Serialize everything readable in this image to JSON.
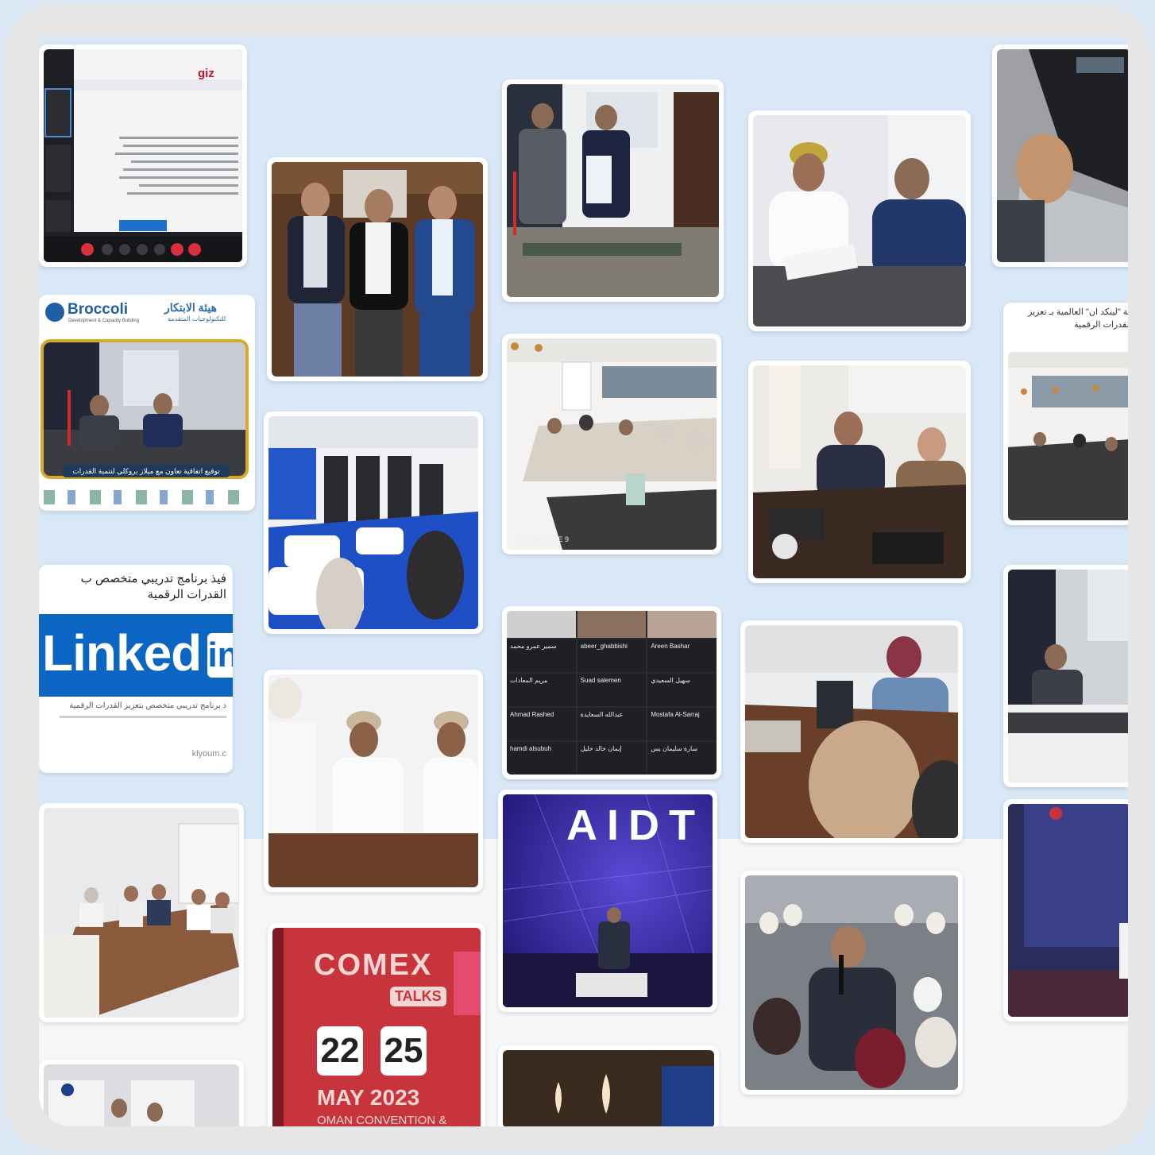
{
  "collage": {
    "logos": {
      "giz": "giz",
      "broccoli": "Broccoli",
      "broccoli_sub": "Development & Capacity Building",
      "innovation_arabic": "هيئة الابتكار",
      "innovation_sub": "للتكنولوجيات المتقدمة"
    },
    "captions": {
      "agreement_banner": "توقيع اتفاقية تعاون مع ميلاز بروكلي لتنمية القدرات",
      "linkedin_headline": "فيذ برنامج تدريبي متخصص ب القدرات الرقمية",
      "linkedin_word": "Linked",
      "linkedin_mark": "in",
      "linkedin_caption": "ذ برنامج تدريبي متخصص بتعزيز القدرات الرقمية",
      "linkedin_source": "klyoum.c",
      "side_headline": "كة \"لينكد ان\" العالمية بـ تعزيز القدرات الرقمية",
      "comex": "COMEX",
      "comex_talks": "TALKS",
      "comex_day1": "22",
      "comex_day2": "25",
      "comex_month": "MAY 2023",
      "comex_venue": "OMAN CONVENTION &",
      "aidt": "AIDT",
      "phone_watermark": "REDMI NOTE 9"
    },
    "video_call": {
      "names": [
        "سمير عمرو محمد",
        "abeer_ghabbishi",
        "Areen Bashar",
        "مريم المعادات",
        "Suad salemen",
        "سهيل السعيدي",
        "Ahmad Rashed",
        "عبدالله السعايدة",
        "Mostafa Al-Sarraj",
        "hamdi alsubuh",
        "إيمان خالد خليل",
        "سارة سليمان يس"
      ]
    },
    "colors": {
      "frame": "#e6e6e6",
      "background": "#d8e8f6",
      "linkedin_blue": "#0a66c2",
      "comex_red": "#c8343b",
      "aidt_purple": "#3b2fa8",
      "broccoli_gold": "#d8a82a"
    }
  }
}
